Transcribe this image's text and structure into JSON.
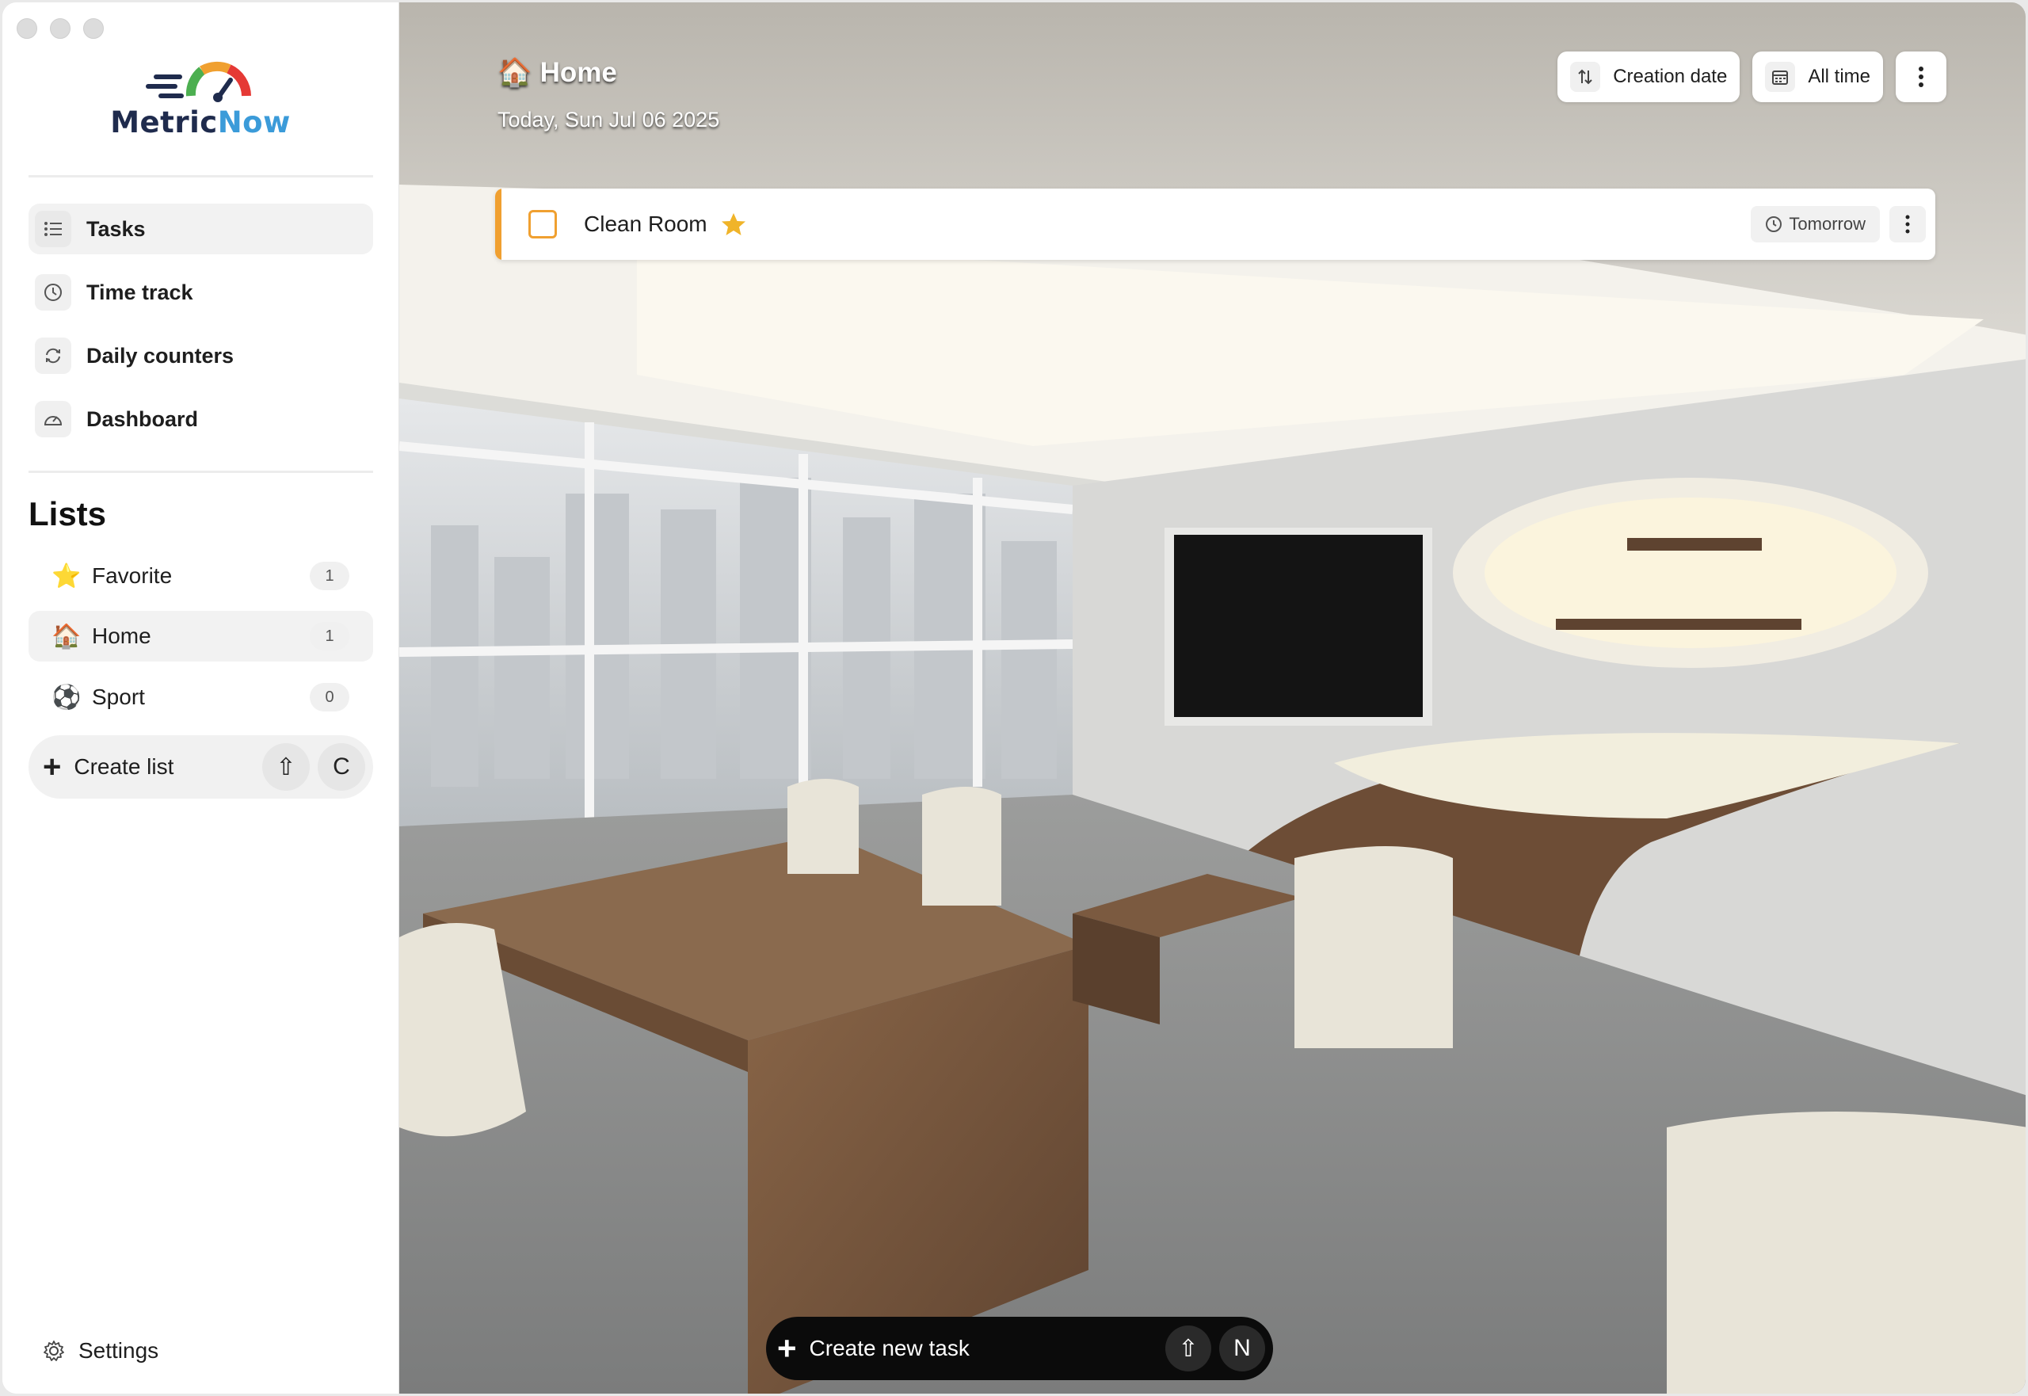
{
  "app": {
    "brand_part1": "Metric",
    "brand_part2": "Now"
  },
  "sidebar": {
    "nav": [
      {
        "label": "Tasks",
        "icon": "list-icon",
        "active": true
      },
      {
        "label": "Time track",
        "icon": "clock-icon"
      },
      {
        "label": "Daily counters",
        "icon": "refresh-icon"
      },
      {
        "label": "Dashboard",
        "icon": "gauge-icon"
      }
    ],
    "lists_title": "Lists",
    "lists": [
      {
        "emoji": "⭐",
        "label": "Favorite",
        "count": "1"
      },
      {
        "emoji": "🏠",
        "label": "Home",
        "count": "1",
        "active": true
      },
      {
        "emoji": "⚽",
        "label": "Sport",
        "count": "0"
      }
    ],
    "create_list": {
      "label": "Create list",
      "shortcut_shift": "⇧",
      "shortcut_key": "C"
    },
    "settings_label": "Settings"
  },
  "header": {
    "emoji": "🏠",
    "title": "Home",
    "date": "Today, Sun Jul 06 2025"
  },
  "toolbar": {
    "sort_label": "Creation date",
    "range_label": "All time"
  },
  "tasks": [
    {
      "title": "Clean Room",
      "favorite": true,
      "due": "Tomorrow"
    }
  ],
  "create_task": {
    "label": "Create new task",
    "shortcut_shift": "⇧",
    "shortcut_key": "N"
  },
  "colors": {
    "accent": "#f0a030",
    "brand_dark": "#1f2b4d",
    "brand_blue": "#3b9bd9"
  }
}
